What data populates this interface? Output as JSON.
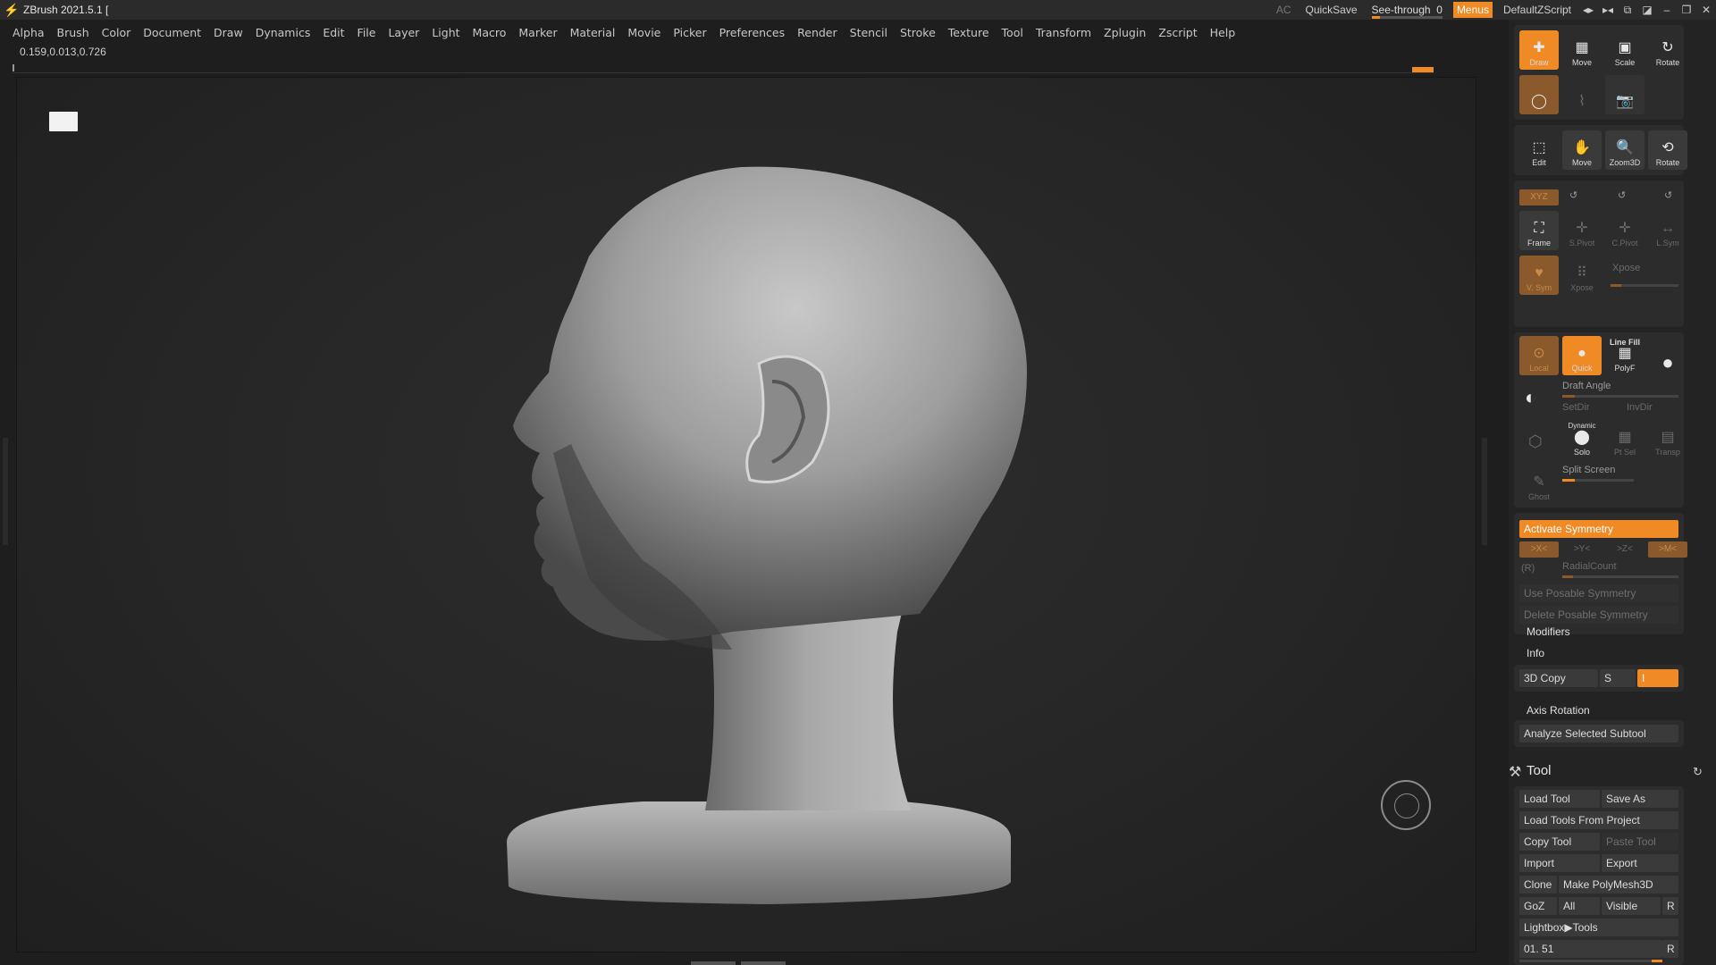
{
  "titlebar": {
    "app_title": "ZBrush 2021.5.1 [",
    "ac": "AC",
    "quicksave": "QuickSave",
    "seethrough_label": "See-through",
    "seethrough_value": "0",
    "seethrough_fraction": 0.12,
    "menus": "Menus",
    "script": "DefaultZScript"
  },
  "menubar": [
    "Alpha",
    "Brush",
    "Color",
    "Document",
    "Draw",
    "Dynamics",
    "Edit",
    "File",
    "Layer",
    "Light",
    "Macro",
    "Marker",
    "Material",
    "Movie",
    "Picker",
    "Preferences",
    "Render",
    "Stencil",
    "Stroke",
    "Texture",
    "Tool",
    "Transform",
    "Zplugin",
    "Zscript",
    "Help"
  ],
  "coords": "0.159,0.013,0.726",
  "shelf1": {
    "draw": "Draw",
    "move": "Move",
    "scale": "Scale",
    "rotate": "Rotate",
    "edit_curve": "Edit"
  },
  "shelf2": {
    "edit": "Edit",
    "move": "Move",
    "zoom3d": "Zoom3D",
    "rotate": "Rotate"
  },
  "shelf3": {
    "xyz": "XYZ",
    "frame": "Frame",
    "spivot": "S.Pivot",
    "cpivot": "C.Pivot",
    "lsym": "L.Sym",
    "vsym": "V. Sym",
    "xpose_btn": "Xpose",
    "xpose": "Xpose"
  },
  "shelf4": {
    "local": "Local",
    "quick": "Quick",
    "linefill": "Line Fill",
    "polyf": "PolyF",
    "draft_angle": "Draft Angle",
    "setdir": "SetDir",
    "invdir": "InvDir",
    "dynamic": "Dynamic",
    "solo": "Solo",
    "ptsel": "Pt Sel",
    "transp": "Transp",
    "ghost": "Ghost",
    "split_screen": "Split Screen"
  },
  "symmetry": {
    "activate": "Activate Symmetry",
    "x": ">X<",
    "y": ">Y<",
    "z": ">Z<",
    "m": ">M<",
    "r": "(R)",
    "radial": "RadialCount",
    "use_posable": "Use Posable Symmetry",
    "delete_posable": "Delete Posable Symmetry"
  },
  "panel": {
    "modifiers": "Modifiers",
    "info": "Info",
    "copy3d": "3D Copy",
    "s": "S",
    "i": "I",
    "axis_rotation": "Axis Rotation",
    "analyze": "Analyze Selected Subtool"
  },
  "tool": {
    "title": "Tool",
    "load_tool": "Load Tool",
    "save_as": "Save As",
    "load_from_project": "Load Tools From Project",
    "copy_tool": "Copy Tool",
    "paste_tool": "Paste Tool",
    "import": "Import",
    "export": "Export",
    "clone": "Clone",
    "make_polymesh": "Make PolyMesh3D",
    "goz": "GoZ",
    "all": "All",
    "visible": "Visible",
    "r": "R",
    "lightbox": "Lightbox▶Tools",
    "count": "01. 51",
    "r2": "R"
  }
}
